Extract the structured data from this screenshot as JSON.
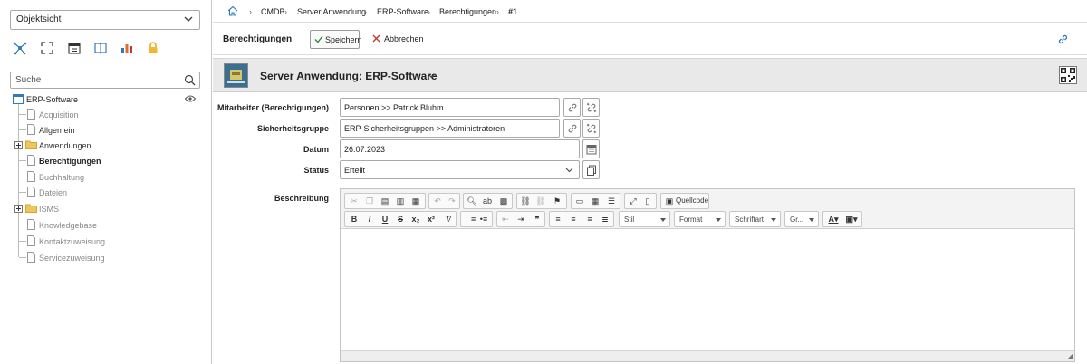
{
  "sidebar": {
    "view_select": "Objektsicht",
    "search_placeholder": "Suche",
    "tree": {
      "root": "ERP-Software",
      "items": [
        {
          "label": "Acquisition",
          "type": "page",
          "state": "dim"
        },
        {
          "label": "Allgemein",
          "type": "page",
          "state": "normal"
        },
        {
          "label": "Anwendungen",
          "type": "folder",
          "state": "normal"
        },
        {
          "label": "Berechtigungen",
          "type": "page",
          "state": "bold"
        },
        {
          "label": "Buchhaltung",
          "type": "page",
          "state": "dim"
        },
        {
          "label": "Dateien",
          "type": "page",
          "state": "dim"
        },
        {
          "label": "ISMS",
          "type": "folder",
          "state": "dim"
        },
        {
          "label": "Knowledgebase",
          "type": "page",
          "state": "dim"
        },
        {
          "label": "Kontaktzuweisung",
          "type": "page",
          "state": "dim"
        },
        {
          "label": "Servicezuweisung",
          "type": "page",
          "state": "dim"
        }
      ]
    },
    "icons": [
      "network-icon",
      "expand-icon",
      "calendar-icon",
      "book-icon",
      "chart-icon",
      "lock-icon"
    ]
  },
  "breadcrumb": {
    "items": [
      "CMDB",
      "Server Anwendung",
      "ERP-Software",
      "Berechtigungen",
      "#1"
    ]
  },
  "toolbar": {
    "title": "Berechtigungen",
    "save_label": "Speichern",
    "cancel_label": "Abbrechen"
  },
  "object": {
    "title": "Server Anwendung: ERP-Software"
  },
  "form": {
    "fields": [
      {
        "label": "Mitarbeiter (Berechtigungen)",
        "value": "Personen >> Patrick Bluhm"
      },
      {
        "label": "Sicherheitsgruppe",
        "value": "ERP-Sicherheitsgruppen >> Administratoren"
      },
      {
        "label": "Datum",
        "value": "26.07.2023"
      },
      {
        "label": "Status",
        "value": "Erteilt"
      },
      {
        "label": "Beschreibung",
        "value": ""
      }
    ]
  },
  "editor": {
    "source_label": "Quellcode",
    "style_label": "Stil",
    "format_label": "Format",
    "font_label": "Schriftart",
    "size_label": "Gr..."
  },
  "colors": {
    "accent": "#2f7ab8",
    "cancel": "#c0392b",
    "folder": "#f0c659",
    "header_bg": "#e9e9e9"
  }
}
